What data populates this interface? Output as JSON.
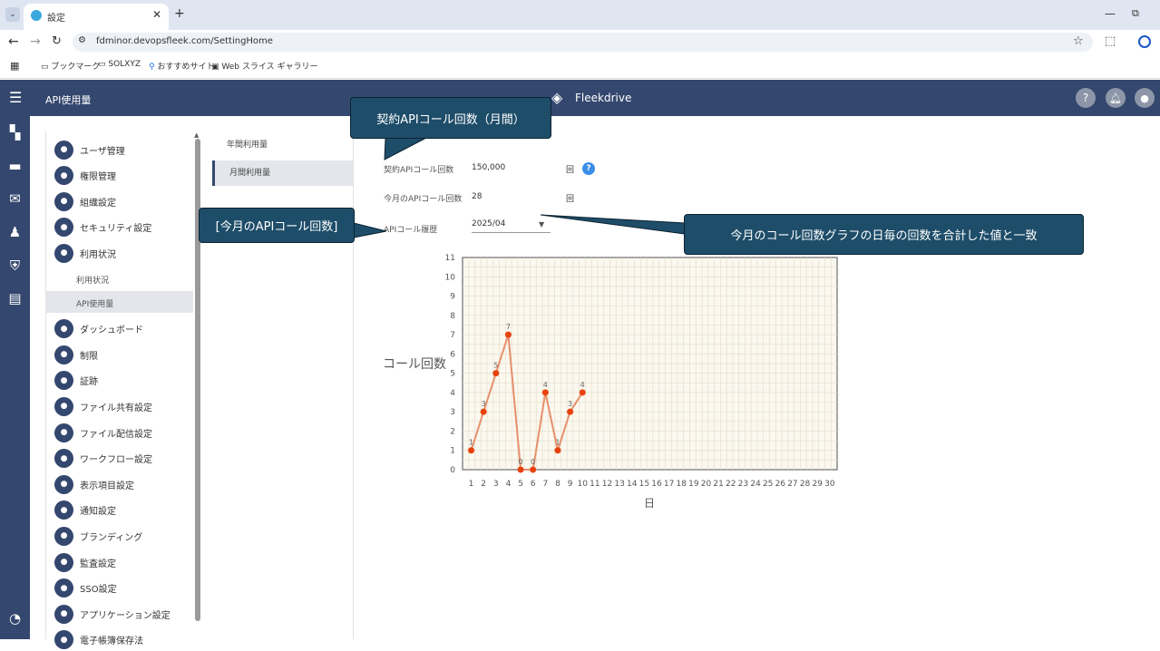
{
  "browser": {
    "tab_title": "設定",
    "url": "fdminor.devopsfleek.com/SettingHome",
    "bookmarks": [
      "ブックマーク",
      "SOLXYZ",
      "おすすめサイト",
      "Web スライス ギャラリー"
    ]
  },
  "app": {
    "page_title": "API使用量",
    "brand": "Fleekdrive",
    "help_icon": "?"
  },
  "sidebar": {
    "items": [
      {
        "label": "ユーザ管理",
        "icon": "user-icon"
      },
      {
        "label": "権限管理",
        "icon": "shield-icon"
      },
      {
        "label": "組織設定",
        "icon": "org-icon"
      },
      {
        "label": "セキュリティ設定",
        "icon": "security-icon"
      },
      {
        "label": "利用状況",
        "icon": "chart-icon"
      },
      {
        "label": "利用状況",
        "sub": true
      },
      {
        "label": "API使用量",
        "sub": true,
        "active": true
      },
      {
        "label": "ダッシュボード",
        "icon": "dashboard-icon"
      },
      {
        "label": "制限",
        "icon": "limit-icon"
      },
      {
        "label": "証跡",
        "icon": "clock-icon"
      },
      {
        "label": "ファイル共有設定",
        "icon": "share-icon"
      },
      {
        "label": "ファイル配信設定",
        "icon": "mail-icon"
      },
      {
        "label": "ワークフロー設定",
        "icon": "workflow-icon"
      },
      {
        "label": "表示項目設定",
        "icon": "list-icon"
      },
      {
        "label": "通知設定",
        "icon": "bell-icon"
      },
      {
        "label": "ブランディング",
        "icon": "brand-icon"
      },
      {
        "label": "監査設定",
        "icon": "audit-icon"
      },
      {
        "label": "SSO設定",
        "icon": "sso-icon"
      },
      {
        "label": "アプリケーション設定",
        "icon": "app-icon"
      },
      {
        "label": "電子帳簿保存法",
        "icon": "book-icon"
      }
    ]
  },
  "tabs": [
    {
      "label": "年間利用量",
      "active": false
    },
    {
      "label": "月間利用量",
      "active": true
    }
  ],
  "fields": {
    "contract_label": "契約APIコール回数",
    "contract_value": "150,000",
    "contract_unit": "回",
    "month_label": "今月のAPIコール回数",
    "month_value": "28",
    "month_unit": "回",
    "history_label": "APIコール履歴",
    "history_value": "2025/04"
  },
  "callouts": {
    "c1": "契約APIコール回数（月間）",
    "c2": "[今月のAPIコール回数]",
    "c3": "今月のコール回数グラフの日毎の回数を合計した値と一致"
  },
  "chart_data": {
    "type": "line",
    "xlabel": "日",
    "ylabel": "コール回数",
    "x": [
      1,
      2,
      3,
      4,
      5,
      6,
      7,
      8,
      9,
      10
    ],
    "values": [
      1,
      3,
      5,
      7,
      0,
      0,
      4,
      1,
      3,
      4
    ],
    "x_ticks": [
      1,
      2,
      3,
      4,
      5,
      6,
      7,
      8,
      9,
      10,
      11,
      12,
      13,
      14,
      15,
      16,
      17,
      18,
      19,
      20,
      21,
      22,
      23,
      24,
      25,
      26,
      27,
      28,
      29,
      30
    ],
    "ylim": [
      0,
      11
    ],
    "xlim": [
      1,
      30
    ],
    "grid": true,
    "line_color": "#e6906c",
    "point_color": "#e8420c"
  }
}
